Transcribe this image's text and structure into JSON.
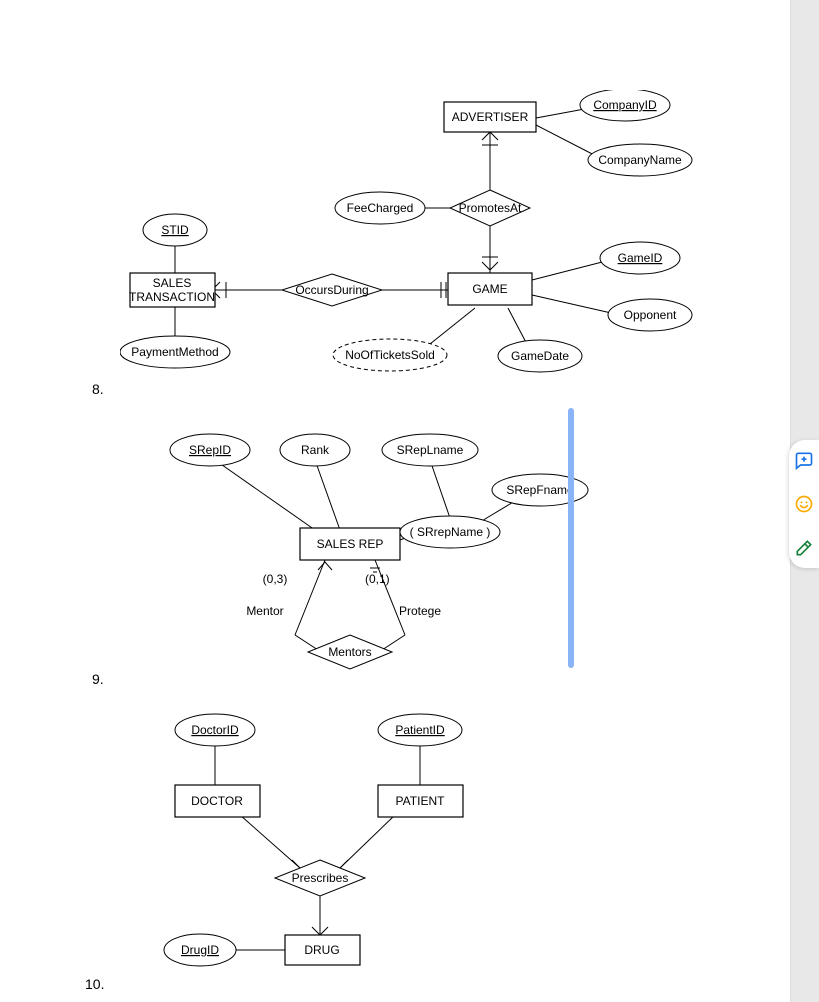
{
  "list_markers": {
    "n8": "8.",
    "n9": "9.",
    "n10": "10."
  },
  "erd8": {
    "entities": {
      "advertiser": "ADVERTISER",
      "sales_transaction": "SALES\nTRANSACTION",
      "game": "GAME"
    },
    "relationships": {
      "promotes_at": "PromotesAt",
      "occurs_during": "OccursDuring"
    },
    "attributes": {
      "company_id": "CompanyID",
      "company_name": "CompanyName",
      "fee_charged": "FeeCharged",
      "stid": "STID",
      "payment_method": "PaymentMethod",
      "no_of_tickets_sold": "NoOfTicketsSold",
      "game_id": "GameID",
      "opponent": "Opponent",
      "game_date": "GameDate"
    }
  },
  "erd9": {
    "entities": {
      "sales_rep": "SALES REP"
    },
    "relationships": {
      "mentors": "Mentors"
    },
    "attributes": {
      "srep_id": "SRepID",
      "rank": "Rank",
      "srep_lname": "SRepLname",
      "srep_fname": "SRepFname",
      "srrep_name": "( SRrepName )"
    },
    "roles": {
      "mentor": "Mentor",
      "protege": "Protege"
    },
    "cardinalities": {
      "mentor": "(0,3)",
      "protege": "(0,1)"
    }
  },
  "erd10": {
    "entities": {
      "doctor": "DOCTOR",
      "patient": "PATIENT",
      "drug": "DRUG"
    },
    "relationships": {
      "prescribes": "Prescribes"
    },
    "attributes": {
      "doctor_id": "DoctorID",
      "patient_id": "PatientID",
      "drug_id": "DrugID"
    }
  },
  "toolbar": {
    "comment": "add-comment",
    "emoji": "add-reaction",
    "suggest": "suggest-edit"
  }
}
